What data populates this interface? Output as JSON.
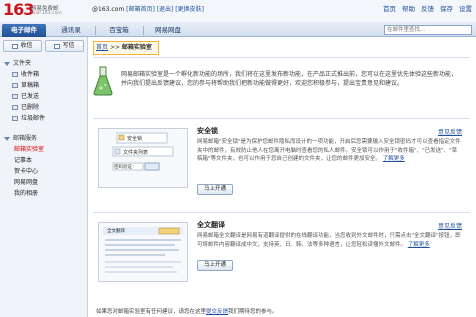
{
  "header": {
    "logo_number": "163",
    "logo_name": "网易免费邮",
    "logo_domain": "mail.163.com",
    "account": "@163.com",
    "account_links": "[邮箱首页] [退出] [更换皮肤]",
    "top_links": [
      "首页",
      "帮助",
      "反馈",
      "保存",
      "设置"
    ]
  },
  "tabs": [
    {
      "label": "电子邮件",
      "active": true
    },
    {
      "label": "通讯录",
      "active": false
    },
    {
      "label": "百宝箱",
      "active": false
    },
    {
      "label": "网易网盘",
      "active": false
    }
  ],
  "search": {
    "placeholder": "在邮件里查找..."
  },
  "sidebar": {
    "actions": [
      {
        "label": "收信",
        "icon": "inbox-icon"
      },
      {
        "label": "写信",
        "icon": "compose-icon"
      }
    ],
    "folders_header": "文件夹",
    "folders": [
      "收件箱",
      "草稿箱",
      "已发送",
      "已删除",
      "垃圾邮件"
    ],
    "labs_header": "邮箱服务",
    "labs": [
      {
        "label": "邮箱实验室",
        "highlight": true
      },
      {
        "label": "记事本",
        "highlight": false
      },
      {
        "label": "贺卡中心",
        "highlight": false
      },
      {
        "label": "网易网盘",
        "highlight": false
      },
      {
        "label": "我的相册",
        "highlight": false
      }
    ]
  },
  "breadcrumb": {
    "home": "首页",
    "sep": ">>",
    "current": "邮箱实验室"
  },
  "intro": {
    "text": "网易邮箱实验室是一个孵化新功能的场所，我们将在这里发布新功能，在产品正式推出前，您可以在这里优先体验这些新功能，并向我们提出反馈建议，您的参与将帮助我们把新功能做得更好，欢迎您积极参与，提出宝贵意见和建议。"
  },
  "features": [
    {
      "title": "安全锁",
      "link": "意见反馈",
      "desc": "网易邮箱\"安全锁\"是为保护您邮件隐私而设计的一项功能，开启后您需要输入安全锁密码才可以查看指定文件夹中的邮件，有效防止他人在您离开电脑时查看您的私人邮件。安全锁可以作用于\"收件箱\"、\"已发送\"、\"草稿箱\"等文件夹，也可以作用于您自己创建的文件夹，让您的邮件更加安全。",
      "more": "了解更多",
      "button": "马上开通",
      "thumb": {
        "title": "安全锁",
        "field": "密码验证：",
        "folder": "文件夹列表"
      }
    },
    {
      "title": "全文翻译",
      "link": "意见反馈",
      "desc": "网易邮箱全文翻译是网易有道翻译提供的在线翻译功能，当您收到外文邮件时，只需点击\"全文翻译\"按钮，即可将邮件内容翻译成中文，支持英、日、韩、法等多种语言，让您轻松读懂外文邮件。",
      "more": "了解更多",
      "button": "马上开通",
      "thumb": {
        "title": "全文翻译"
      }
    }
  ],
  "footer": {
    "text": "如果您对邮箱实验室有任何建议，请您在这里",
    "link": "提交反馈",
    "text2": "我们期待您的参与。"
  },
  "colors": {
    "accent": "#214f94",
    "brand": "#c8161d",
    "link": "#1f4f9c",
    "highlight_border": "#f0b43a"
  }
}
